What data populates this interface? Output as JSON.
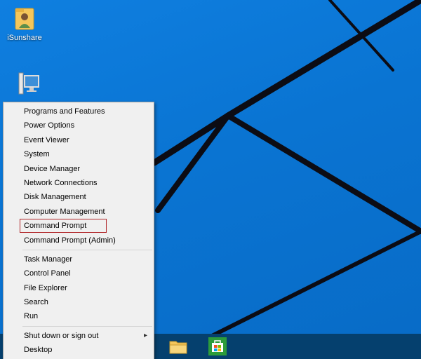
{
  "desktop": {
    "icons": [
      {
        "label": "iSunshare",
        "icon": "user-folder-icon"
      },
      {
        "label": "",
        "icon": "this-pc-icon"
      }
    ]
  },
  "context_menu": {
    "groups": [
      {
        "items": [
          {
            "label": "Programs and Features"
          },
          {
            "label": "Power Options"
          },
          {
            "label": "Event Viewer"
          },
          {
            "label": "System"
          },
          {
            "label": "Device Manager"
          },
          {
            "label": "Network Connections"
          },
          {
            "label": "Disk Management"
          },
          {
            "label": "Computer Management"
          },
          {
            "label": "Command Prompt",
            "highlighted": true
          },
          {
            "label": "Command Prompt (Admin)"
          }
        ]
      },
      {
        "items": [
          {
            "label": "Task Manager"
          },
          {
            "label": "Control Panel"
          },
          {
            "label": "File Explorer"
          },
          {
            "label": "Search"
          },
          {
            "label": "Run"
          }
        ]
      },
      {
        "items": [
          {
            "label": "Shut down or sign out",
            "submenu": true
          },
          {
            "label": "Desktop"
          }
        ]
      }
    ]
  },
  "taskbar": {
    "items": [
      {
        "icon": "file-explorer-icon"
      },
      {
        "icon": "store-icon"
      }
    ]
  },
  "colors": {
    "desktop_blue": "#0a78d7",
    "highlight_border": "#b0262a",
    "taskbar": "#05406e"
  }
}
